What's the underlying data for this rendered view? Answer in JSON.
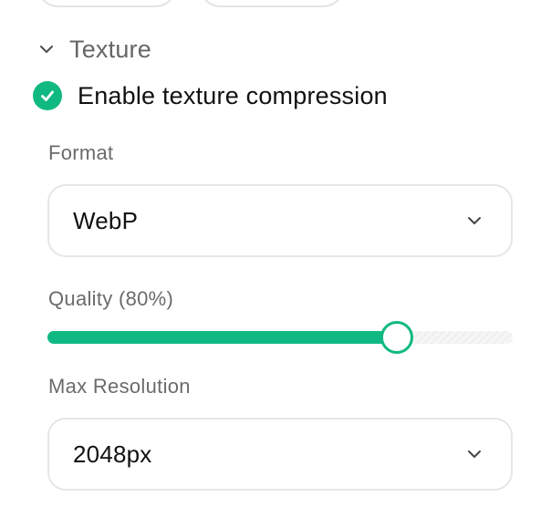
{
  "section": {
    "title": "Texture",
    "expanded": true
  },
  "compression": {
    "label": "Enable texture compression",
    "checked": true
  },
  "format": {
    "label": "Format",
    "value": "WebP"
  },
  "quality": {
    "label": "Quality (80%)",
    "fraction": 0.75
  },
  "max_resolution": {
    "label": "Max Resolution",
    "value": "2048px"
  },
  "icons": {
    "section_toggle": "chevron-down-icon",
    "checkbox": "checkmark-icon",
    "select": "chevron-down-icon"
  },
  "colors": {
    "accent": "#10b981",
    "label_gray": "#6b6b6b",
    "border": "#e6e6e6"
  }
}
